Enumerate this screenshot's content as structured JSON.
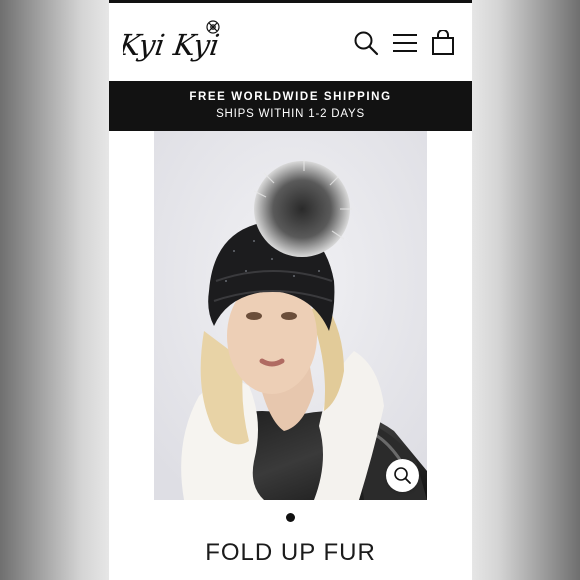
{
  "header": {
    "logo_text": "Kyi Kyi",
    "icons": [
      "search-icon",
      "menu-icon",
      "cart-icon"
    ]
  },
  "banner": {
    "line1": "FREE WORLDWIDE SHIPPING",
    "line2": "SHIPS WITHIN 1-2 DAYS"
  },
  "product": {
    "title": "FOLD UP FUR",
    "image_icon": "zoom-icon"
  },
  "carousel": {
    "active_index": 1,
    "count": 1
  },
  "colors": {
    "banner_bg": "#121212",
    "text": "#1b1b1b",
    "background": "#ffffff"
  }
}
